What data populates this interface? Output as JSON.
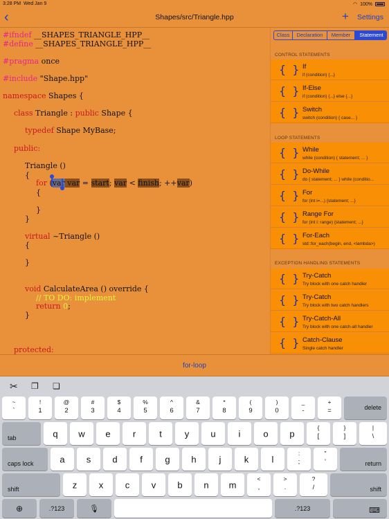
{
  "status": {
    "time": "3:28 PM",
    "date": "Wed Jan 9",
    "battery": "100%"
  },
  "nav": {
    "title": "Shapes/src/Triangle.hpp",
    "settings": "Settings"
  },
  "code": {
    "l1a": "#ifndef",
    "l1b": " __SHAPES_TRIANGLE_HPP__",
    "l2a": "#define",
    "l2b": " __SHAPES_TRIANGLE_HPP__",
    "l3a": "#pragma",
    "l3b": " once",
    "l4a": "#include",
    "l4b": " \"Shape.hpp\"",
    "l5a": "namespace",
    "l5b": " Shapes {",
    "l6a": "class",
    "l6b": " Triangle : ",
    "l6c": "public",
    "l6d": " Shape {",
    "l7a": "typedef",
    "l7b": " Shape MyBase;",
    "l8": "public:",
    "l9": "Triangle ()",
    "l10": "{",
    "l11a": "for",
    "l11b": " (",
    "l11c": "var",
    "l11d": " var",
    "l11e": " = ",
    "l11f": "start",
    "l11g": "; ",
    "l11h": "var",
    "l11i": " < ",
    "l11j": "finish",
    "l11k": "; ++",
    "l11l": "var",
    "l11m": ")",
    "l12": "{",
    "l13": "}",
    "l14": "}",
    "l15a": "virtual",
    "l15b": " ~Triangle ()",
    "l16": "{",
    "l17": "}",
    "l18a": "void",
    "l18b": " CalculateArea () override {",
    "l19": "// TO DO: implement",
    "l20a": "return",
    "l20b": " ",
    "l20c": "0",
    "l20d": ";",
    "l21": "}",
    "l22": "protected:"
  },
  "segments": [
    "Class",
    "Declaration",
    "Member",
    "Statement"
  ],
  "sections": {
    "control": "CONTROL STATEMENTS",
    "loop": "LOOP STATEMENTS",
    "exception": "EXCEPTION HANDLING STATEMENTS"
  },
  "brace_icon": "{ }",
  "items": {
    "if": {
      "name": "If",
      "desc": "if (condition) {...}"
    },
    "ifelse": {
      "name": "If-Else",
      "desc": "if (condition) {...} else {...}"
    },
    "switch": {
      "name": "Switch",
      "desc": "switch (condition) { case... }"
    },
    "while": {
      "name": "While",
      "desc": "while (condition) { statement; ... }"
    },
    "dowhile": {
      "name": "Do-While",
      "desc": "do { statement; ... } while (conditio..."
    },
    "for": {
      "name": "For",
      "desc": "for (int i=...) {statement; ...}"
    },
    "rangefor": {
      "name": "Range For",
      "desc": "for (int i: range) {statement; ...}"
    },
    "foreach": {
      "name": "For-Each",
      "desc": "std::for_each(begin, end, <lambda>)"
    },
    "trycatch1": {
      "name": "Try-Catch",
      "desc": "Try block with one catch handler"
    },
    "trycatch2": {
      "name": "Try-Catch",
      "desc": "Try block with two catch handlers"
    },
    "trycatchall": {
      "name": "Try-Catch-All",
      "desc": "Try block with one catch-all handler"
    },
    "catchclause": {
      "name": "Catch-Clause",
      "desc": "Single catch handler"
    }
  },
  "accessory": {
    "label": "for-loop"
  },
  "keyboard": {
    "row1": [
      {
        "t": "~",
        "b": "`"
      },
      {
        "t": "!",
        "b": "1"
      },
      {
        "t": "@",
        "b": "2"
      },
      {
        "t": "#",
        "b": "3"
      },
      {
        "t": "$",
        "b": "4"
      },
      {
        "t": "%",
        "b": "5"
      },
      {
        "t": "^",
        "b": "6"
      },
      {
        "t": "&",
        "b": "7"
      },
      {
        "t": "*",
        "b": "8"
      },
      {
        "t": "(",
        "b": "9"
      },
      {
        "t": ")",
        "b": "0"
      },
      {
        "t": "_",
        "b": "-"
      },
      {
        "t": "+",
        "b": "="
      }
    ],
    "delete": "delete",
    "tab": "tab",
    "row2": [
      "q",
      "w",
      "e",
      "r",
      "t",
      "y",
      "u",
      "i",
      "o",
      "p"
    ],
    "row2p": [
      {
        "t": "{",
        "b": "["
      },
      {
        "t": "}",
        "b": "]"
      },
      {
        "t": "|",
        "b": "\\"
      }
    ],
    "capslock": "caps lock",
    "row3": [
      "a",
      "s",
      "d",
      "f",
      "g",
      "h",
      "j",
      "k",
      "l"
    ],
    "row3p": [
      {
        "t": ":",
        "b": ";"
      },
      {
        "t": "\"",
        "b": "'"
      }
    ],
    "return": "return",
    "shift": "shift",
    "row4": [
      "z",
      "x",
      "c",
      "v",
      "b",
      "n",
      "m"
    ],
    "row4p": [
      {
        "t": "<",
        "b": ","
      },
      {
        "t": ">",
        "b": "."
      },
      {
        "t": "?",
        "b": "/"
      }
    ],
    "numbers": ".?123"
  }
}
